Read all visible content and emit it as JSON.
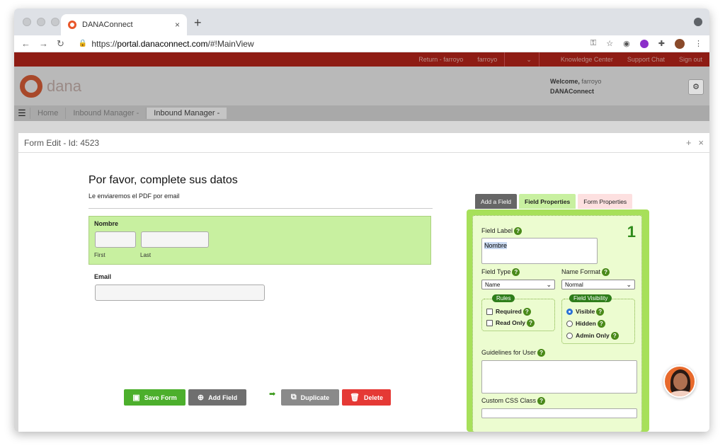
{
  "browser": {
    "tab_title": "DANAConnect",
    "tab_close": "×",
    "new_tab": "+",
    "url_prefix": "https://",
    "url_host": "portal.danaconnect.com",
    "url_path": "/#!MainView"
  },
  "app": {
    "topnav": {
      "return": "Return - farroyo",
      "user": "farroyo",
      "knowledge": "Knowledge Center",
      "support": "Support Chat",
      "signout": "Sign out"
    },
    "logo_text": "dana",
    "welcome_label": "Welcome,",
    "welcome_user": "farroyo",
    "company": "DANAConnect",
    "breadcrumbs": [
      "Home",
      "Inbound Manager -",
      "Inbound Manager -"
    ]
  },
  "modal": {
    "title": "Form Edit - Id: 4523",
    "ctrl_add": "+",
    "ctrl_close": "×"
  },
  "form": {
    "heading": "Por favor, complete sus datos",
    "subheading": "Le enviaremos el PDF por email",
    "name_label": "Nombre",
    "first_label": "First",
    "last_label": "Last",
    "email_label": "Email",
    "buttons": {
      "save": "Save Form",
      "add": "Add Field",
      "duplicate": "Duplicate",
      "delete": "Delete"
    }
  },
  "panel": {
    "tabs": [
      "Add a Field",
      "Field Properties",
      "Form Properties"
    ],
    "field_number": "1",
    "field_label_title": "Field Label",
    "field_label_value": "Nombre",
    "field_type_title": "Field Type",
    "field_type_value": "Name",
    "name_format_title": "Name Format",
    "name_format_value": "Normal",
    "rules_title": "Rules",
    "rule_required": "Required",
    "rule_readonly": "Read Only",
    "visibility_title": "Field Visibility",
    "vis_visible": "Visible",
    "vis_hidden": "Hidden",
    "vis_admin": "Admin Only",
    "guidelines_title": "Guidelines for User",
    "css_title": "Custom CSS Class",
    "help_glyph": "?"
  },
  "colors": {
    "save_button": "#4caf2c",
    "add_button": "#6f6f6f",
    "duplicate_button": "#8a8a8a",
    "delete_button": "#e53935",
    "selected_field_bg": "#c8f0a0",
    "panel_bg": "#a7e05a",
    "topnav_bg": "#8e1c14"
  }
}
